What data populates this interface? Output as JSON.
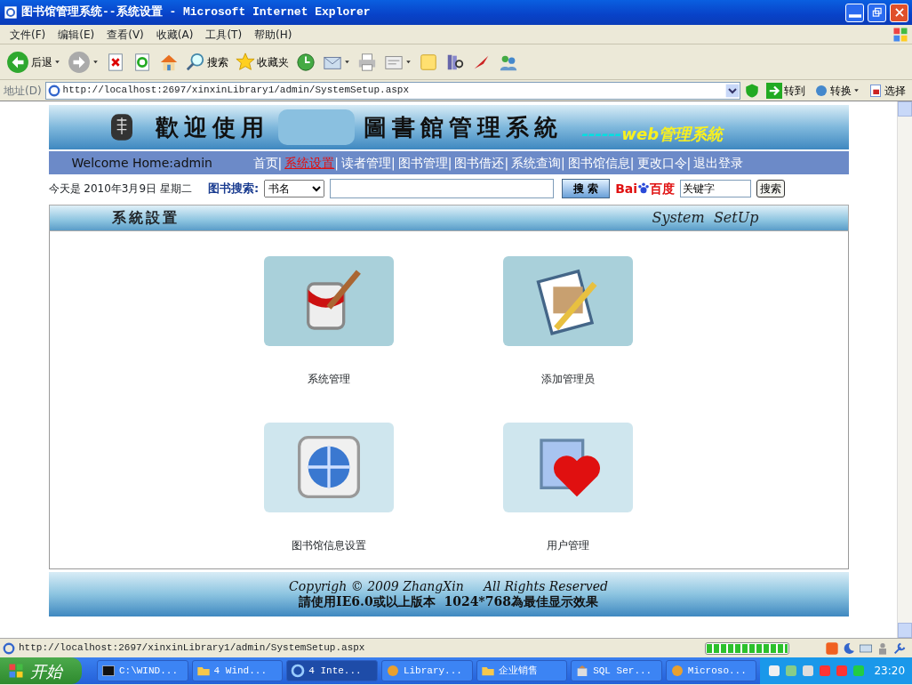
{
  "window": {
    "title": "图书馆管理系统--系统设置 - Microsoft Internet Explorer"
  },
  "menu": [
    "文件(F)",
    "编辑(E)",
    "查看(V)",
    "收藏(A)",
    "工具(T)",
    "帮助(H)"
  ],
  "toolbar": [
    {
      "kind": "back",
      "label": "后退",
      "dropdown": true
    },
    {
      "kind": "forward",
      "dropdown": true
    },
    {
      "kind": "stop"
    },
    {
      "kind": "refresh"
    },
    {
      "kind": "home"
    },
    {
      "kind": "search",
      "label": "搜索"
    },
    {
      "kind": "favorites",
      "label": "收藏夹"
    },
    {
      "kind": "history"
    },
    {
      "kind": "mail",
      "dropdown": true
    },
    {
      "kind": "print"
    },
    {
      "kind": "edit",
      "dropdown": true
    },
    {
      "kind": "note"
    },
    {
      "kind": "research"
    },
    {
      "kind": "pen"
    },
    {
      "kind": "messenger"
    }
  ],
  "address": {
    "label": "地址(D)",
    "url": "http://localhost:2697/xinxinLibrary1/admin/SystemSetup.aspx",
    "go": "转到",
    "convert": "转换",
    "select": "选择"
  },
  "page": {
    "banner": {
      "title_left": "歡迎使用",
      "title_right": "圖書館管理系統",
      "dashes": "------",
      "subtitle": "web管理系統"
    },
    "nav": {
      "welcome": "Welcome Home:admin",
      "separator": "|",
      "links": [
        {
          "label": "首页",
          "selected": false
        },
        {
          "label": "系统设置",
          "selected": true
        },
        {
          "label": "读者管理",
          "selected": false
        },
        {
          "label": "图书管理",
          "selected": false
        },
        {
          "label": "图书借还",
          "selected": false
        },
        {
          "label": "系统查询",
          "selected": false
        },
        {
          "label": "图书馆信息",
          "selected": false
        },
        {
          "label": "更改口令",
          "selected": false
        },
        {
          "label": "退出登录",
          "selected": false
        }
      ]
    },
    "search": {
      "date": "今天是 2010年3月9日 星期二",
      "label": "图书搜索:",
      "option": "书名",
      "button": "搜 索",
      "baidu_left": "Bai",
      "baidu_right": "百度",
      "keyword": "关键字",
      "baidu_button": "搜索"
    },
    "section": {
      "title": "系統設置",
      "subtitle": "System  SetUp"
    },
    "tiles": [
      {
        "kind": "paint",
        "label": "系统管理"
      },
      {
        "kind": "document",
        "label": "添加管理员"
      },
      {
        "kind": "globe",
        "label": "图书馆信息设置"
      },
      {
        "kind": "heart",
        "label": "用户管理"
      }
    ],
    "footer": [
      "Copyrigh © 2009 ZhangXin     All Rights Reserved",
      "請使用IE6.0或以上版本  1024*768為最佳显示效果"
    ]
  },
  "status_bar": {
    "url": "http://localhost:2697/xinxinLibrary1/admin/SystemSetup.aspx",
    "level": 1
  },
  "taskbar": {
    "start": "开始",
    "tasks": [
      {
        "kind": "console",
        "label": "C:\\WIND...",
        "selected": false
      },
      {
        "kind": "folder",
        "label": "4 Wind...",
        "selected": false
      },
      {
        "kind": "browser",
        "label": "4 Inte...",
        "selected": true
      },
      {
        "kind": "app",
        "label": "Library...",
        "selected": false
      },
      {
        "kind": "folder",
        "label": "企业销售",
        "selected": false
      },
      {
        "kind": "tool",
        "label": "SQL Ser...",
        "selected": false
      },
      {
        "kind": "app",
        "label": "Microso...",
        "selected": false
      }
    ],
    "clock": "23:20"
  }
}
